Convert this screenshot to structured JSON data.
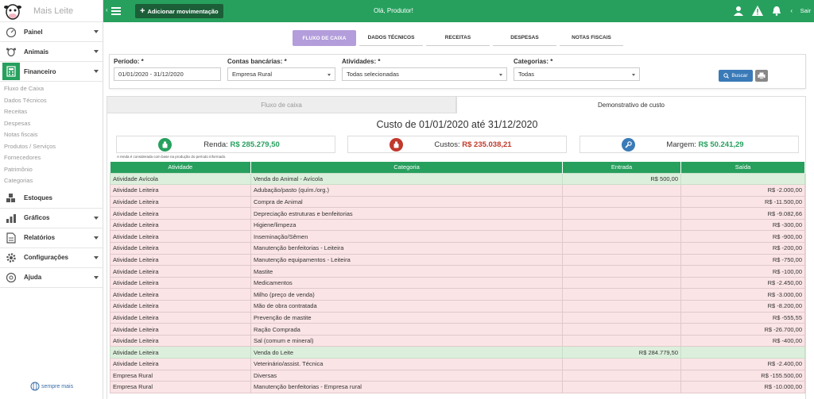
{
  "app": {
    "name": "Mais Leite",
    "footer_brand": "sempre mais"
  },
  "sidebar": {
    "items": [
      {
        "label": "Painel",
        "icon": "speedometer-icon"
      },
      {
        "label": "Animais",
        "icon": "cow-icon"
      },
      {
        "label": "Financeiro",
        "icon": "calculator-icon",
        "active": true
      },
      {
        "label": "Estoques",
        "icon": "boxes-icon"
      },
      {
        "label": "Gráficos",
        "icon": "bar-chart-icon"
      },
      {
        "label": "Relatórios",
        "icon": "report-icon"
      },
      {
        "label": "Configurações",
        "icon": "gear-icon"
      },
      {
        "label": "Ajuda",
        "icon": "help-icon"
      }
    ],
    "submenu": [
      "Fluxo de Caixa",
      "Dados Técnicos",
      "Receitas",
      "Despesas",
      "Notas fiscais",
      "Produtos / Serviços",
      "Fornecedores",
      "Patrimônio",
      "Categorias"
    ]
  },
  "topbar": {
    "add_label": "Adicionar movimentação",
    "greeting": "Olá, Produtor!",
    "logout": "Sair"
  },
  "tabs": [
    "FLUXO DE CAIXA",
    "DADOS TÉCNICOS",
    "RECEITAS",
    "DESPESAS",
    "NOTAS FISCAIS"
  ],
  "filters": {
    "periodo_label": "Período: *",
    "periodo_value": "01/01/2020 - 31/12/2020",
    "contas_label": "Contas bancárias: *",
    "contas_value": "Empresa Rural",
    "atividades_label": "Atividades: *",
    "atividades_value": "Todas selecionadas",
    "categorias_label": "Categorias: *",
    "categorias_value": "Todas",
    "buscar": "Buscar"
  },
  "subtabs": [
    "Fluxo de caixa",
    "Demonstrativo de custo"
  ],
  "report": {
    "title": "Custo de 01/01/2020 até 31/12/2020",
    "renda_label": "Renda:",
    "renda_value": "R$ 285.279,50",
    "custos_label": "Custos:",
    "custos_value": "R$ 235.038,21",
    "margem_label": "Margem:",
    "margem_value": "R$ 50.241,29",
    "note": "A renda é considerada com base na produção do período informado.",
    "columns": [
      "Atividade",
      "Categoria",
      "Entrada",
      "Saída"
    ],
    "rows": [
      {
        "atividade": "Atividade Avícola",
        "categoria": "Venda do Animal - Avícola",
        "entrada": "R$ 500,00",
        "saida": "",
        "type": "pos"
      },
      {
        "atividade": "Atividade Leiteira",
        "categoria": "Adubação/pasto (quím./org.)",
        "entrada": "",
        "saida": "R$ -2.000,00",
        "type": "neg"
      },
      {
        "atividade": "Atividade Leiteira",
        "categoria": "Compra de Animal",
        "entrada": "",
        "saida": "R$ -11.500,00",
        "type": "neg"
      },
      {
        "atividade": "Atividade Leiteira",
        "categoria": "Depreciação estruturas e benfeitorias",
        "entrada": "",
        "saida": "R$ -9.082,66",
        "type": "neg"
      },
      {
        "atividade": "Atividade Leiteira",
        "categoria": "Higiene/limpeza",
        "entrada": "",
        "saida": "R$ -300,00",
        "type": "neg"
      },
      {
        "atividade": "Atividade Leiteira",
        "categoria": "Inseminação/Sêmen",
        "entrada": "",
        "saida": "R$ -900,00",
        "type": "neg"
      },
      {
        "atividade": "Atividade Leiteira",
        "categoria": "Manutenção benfeitorias - Leiteira",
        "entrada": "",
        "saida": "R$ -200,00",
        "type": "neg"
      },
      {
        "atividade": "Atividade Leiteira",
        "categoria": "Manutenção equipamentos - Leiteira",
        "entrada": "",
        "saida": "R$ -750,00",
        "type": "neg"
      },
      {
        "atividade": "Atividade Leiteira",
        "categoria": "Mastite",
        "entrada": "",
        "saida": "R$ -100,00",
        "type": "neg"
      },
      {
        "atividade": "Atividade Leiteira",
        "categoria": "Medicamentos",
        "entrada": "",
        "saida": "R$ -2.450,00",
        "type": "neg"
      },
      {
        "atividade": "Atividade Leiteira",
        "categoria": "Milho (preço de venda)",
        "entrada": "",
        "saida": "R$ -3.000,00",
        "type": "neg"
      },
      {
        "atividade": "Atividade Leiteira",
        "categoria": "Mão de obra contratada",
        "entrada": "",
        "saida": "R$ -8.200,00",
        "type": "neg"
      },
      {
        "atividade": "Atividade Leiteira",
        "categoria": "Prevenção de mastite",
        "entrada": "",
        "saida": "R$ -555,55",
        "type": "neg"
      },
      {
        "atividade": "Atividade Leiteira",
        "categoria": "Ração Comprada",
        "entrada": "",
        "saida": "R$ -26.700,00",
        "type": "neg"
      },
      {
        "atividade": "Atividade Leiteira",
        "categoria": "Sal (comum e mineral)",
        "entrada": "",
        "saida": "R$ -400,00",
        "type": "neg"
      },
      {
        "atividade": "Atividade Leiteira",
        "categoria": "Venda do Leite",
        "entrada": "R$ 284.779,50",
        "saida": "",
        "type": "pos"
      },
      {
        "atividade": "Atividade Leiteira",
        "categoria": "Veterinário/assist. Técnica",
        "entrada": "",
        "saida": "R$ -2.400,00",
        "type": "neg"
      },
      {
        "atividade": "Empresa Rural",
        "categoria": "Diversas",
        "entrada": "",
        "saida": "R$ -155.500,00",
        "type": "neg"
      },
      {
        "atividade": "Empresa Rural",
        "categoria": "Manutenção benfeitorias - Empresa rural",
        "entrada": "",
        "saida": "R$ -10.000,00",
        "type": "neg"
      }
    ]
  },
  "colors": {
    "green": "#27a05e",
    "dark_green": "#1b5e38",
    "purple": "#b39ddb",
    "red": "#c0392b",
    "blue": "#3a7ab8"
  }
}
